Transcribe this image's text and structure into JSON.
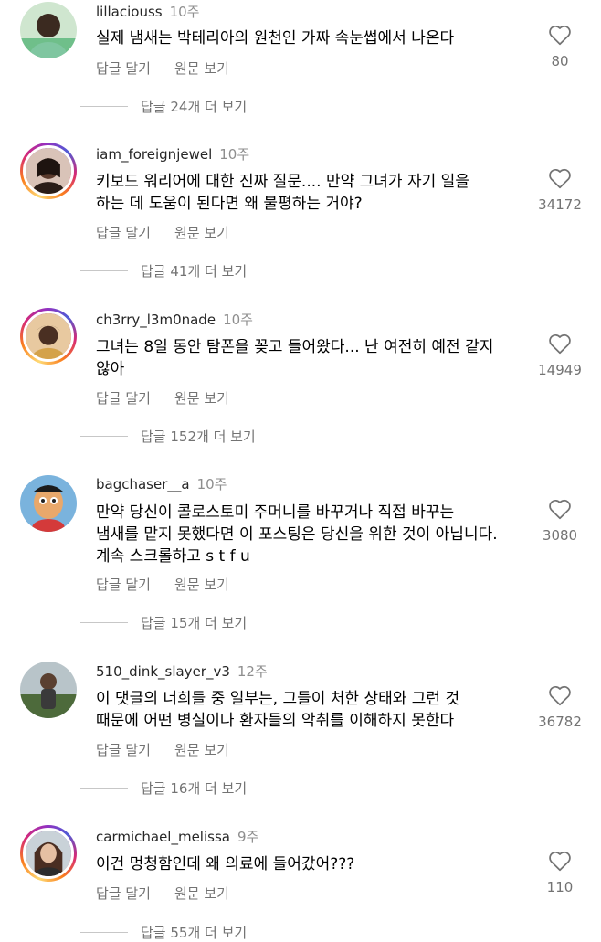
{
  "comments": [
    {
      "username": "lillaciouss",
      "time": "10주",
      "lines": [
        "실제 냄새는 박테리아의 원천인 가짜 속눈썹에서 나온다"
      ],
      "reply_label": "답글 달기",
      "translate_label": "원문 보기",
      "likes": "80",
      "view_replies": "답글 24개 더 보기",
      "avatar_icon": "avatar-photo-icon",
      "story_ring": false
    },
    {
      "username": "iam_foreignjewel",
      "time": "10주",
      "lines": [
        "키보드 워리어에 대한 진짜 질문.... 만약 그녀가 자기 일을",
        "하는 데 도움이 된다면 왜 불평하는 거야?"
      ],
      "reply_label": "답글 달기",
      "translate_label": "원문 보기",
      "likes": "34172",
      "view_replies": "답글 41개 더 보기",
      "avatar_icon": "avatar-photo-icon",
      "story_ring": true
    },
    {
      "username": "ch3rry_l3m0nade",
      "time": "10주",
      "lines": [
        "그녀는 8일 동안 탐폰을 꽂고 들어왔다... 난 여전히 예전 같지",
        "않아"
      ],
      "reply_label": "답글 달기",
      "translate_label": "원문 보기",
      "likes": "14949",
      "view_replies": "답글 152개 더 보기",
      "avatar_icon": "avatar-photo-icon",
      "story_ring": true
    },
    {
      "username": "bagchaser__a",
      "time": "10주",
      "lines": [
        "만약 당신이 콜로스토미 주머니를 바꾸거나 직접 바꾸는",
        "냄새를 맡지 못했다면 이 포스팅은 당신을 위한 것이 아닙니다.",
        "계속 스크롤하고 s t f u"
      ],
      "reply_label": "답글 달기",
      "translate_label": "원문 보기",
      "likes": "3080",
      "view_replies": "답글 15개 더 보기",
      "avatar_icon": "avatar-cartoon-icon",
      "story_ring": false
    },
    {
      "username": "510_dink_slayer_v3",
      "time": "12주",
      "lines": [
        "이 댓글의 너희들 중 일부는, 그들이 처한 상태와 그런 것",
        "때문에 어떤 병실이나 환자들의 악취를 이해하지 못한다"
      ],
      "reply_label": "답글 달기",
      "translate_label": "원문 보기",
      "likes": "36782",
      "view_replies": "답글 16개 더 보기",
      "avatar_icon": "avatar-photo-icon",
      "story_ring": false
    },
    {
      "username": "carmichael_melissa",
      "time": "9주",
      "lines": [
        "이건 멍청함인데 왜 의료에 들어갔어???"
      ],
      "reply_label": "답글 달기",
      "translate_label": "원문 보기",
      "likes": "110",
      "view_replies": "답글 55개 더 보기",
      "avatar_icon": "avatar-photo-icon",
      "story_ring": true
    }
  ],
  "colors": {
    "text": "#000000",
    "secondary": "#737373",
    "ring": [
      "#feda75",
      "#fa7e1e",
      "#d62976",
      "#962fbf",
      "#4f5bd5"
    ]
  }
}
